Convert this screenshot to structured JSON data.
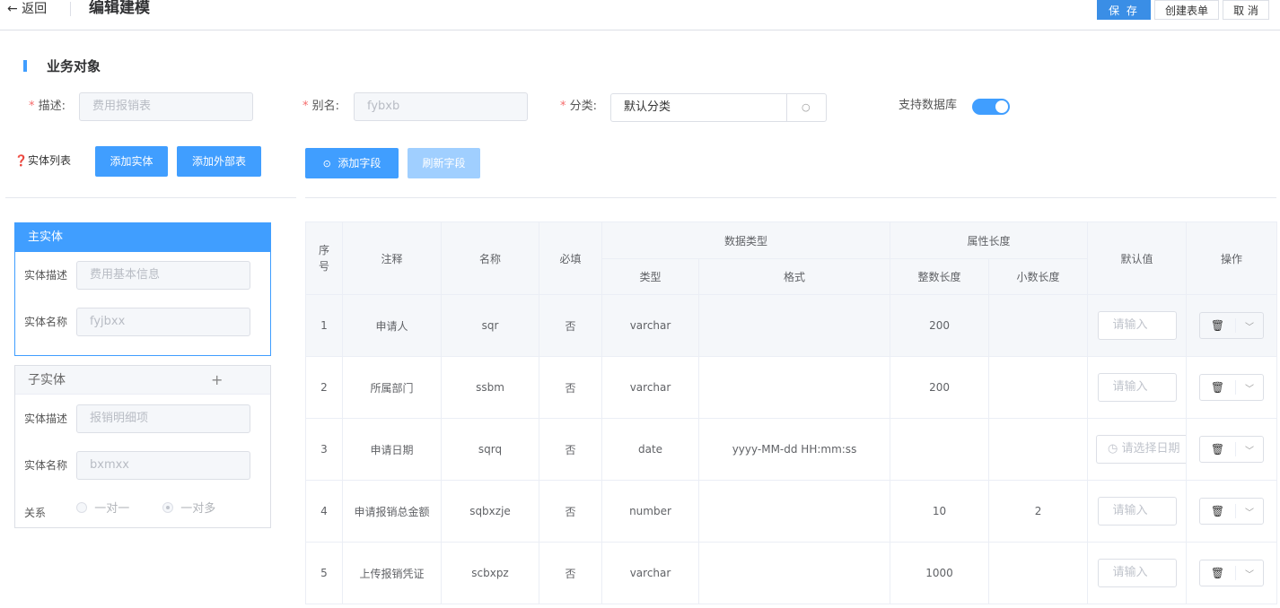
{
  "header": {
    "back_label": "← 返回",
    "title": "编辑建模",
    "save_label": "保 存",
    "create_form_label": "创建表单",
    "cancel_label": "取 消"
  },
  "section": {
    "title": "业务对象"
  },
  "form": {
    "desc_label": "描述:",
    "desc_value": "费用报销表",
    "alias_label": "别名:",
    "alias_value": "fybxb",
    "category_label": "分类:",
    "category_value": "默认分类",
    "db_label": "支持数据库",
    "db_enabled": true
  },
  "entity_toolbar": {
    "list_label": "实体列表",
    "add_entity": "添加实体",
    "add_external": "添加外部表"
  },
  "field_toolbar": {
    "add_field": "添加字段",
    "refresh_field": "刷新字段"
  },
  "main_entity": {
    "title": "主实体",
    "desc_label": "实体描述",
    "desc_value": "费用基本信息",
    "name_label": "实体名称",
    "name_value": "fyjbxx"
  },
  "sub_entity": {
    "title": "子实体",
    "add_icon": "plus-icon",
    "desc_label": "实体描述",
    "desc_value": "报销明细项",
    "name_label": "实体名称",
    "name_value": "bxmxx",
    "relation_label": "关系",
    "opt_one": "一对一",
    "opt_many": "一对多",
    "selected": "一对多"
  },
  "table": {
    "headers": {
      "seq": "序号",
      "comment": "注释",
      "name": "名称",
      "required": "必填",
      "data_type": "数据类型",
      "type": "类型",
      "format": "格式",
      "attr_len": "属性长度",
      "int_len": "整数长度",
      "dec_len": "小数长度",
      "default": "默认值",
      "ops": "操作"
    },
    "rows": [
      {
        "seq": "1",
        "comment": "申请人",
        "name": "sqr",
        "required": "否",
        "type": "varchar",
        "format": "",
        "int_len": "200",
        "dec_len": "",
        "default_placeholder": "请输入"
      },
      {
        "seq": "2",
        "comment": "所属部门",
        "name": "ssbm",
        "required": "否",
        "type": "varchar",
        "format": "",
        "int_len": "200",
        "dec_len": "",
        "default_placeholder": "请输入"
      },
      {
        "seq": "3",
        "comment": "申请日期",
        "name": "sqrq",
        "required": "否",
        "type": "date",
        "format": "yyyy-MM-dd HH:mm:ss",
        "int_len": "",
        "dec_len": "",
        "default_placeholder": "请选择日期"
      },
      {
        "seq": "4",
        "comment": "申请报销总金额",
        "name": "sqbxzje",
        "required": "否",
        "type": "number",
        "format": "",
        "int_len": "10",
        "dec_len": "2",
        "default_placeholder": "请输入"
      },
      {
        "seq": "5",
        "comment": "上传报销凭证",
        "name": "scbxpz",
        "required": "否",
        "type": "varchar",
        "format": "",
        "int_len": "1000",
        "dec_len": "",
        "default_placeholder": "请输入"
      }
    ]
  },
  "colors": {
    "primary": "#409eff",
    "header_bg": "#f5f7fa",
    "border": "#ebeef5"
  }
}
